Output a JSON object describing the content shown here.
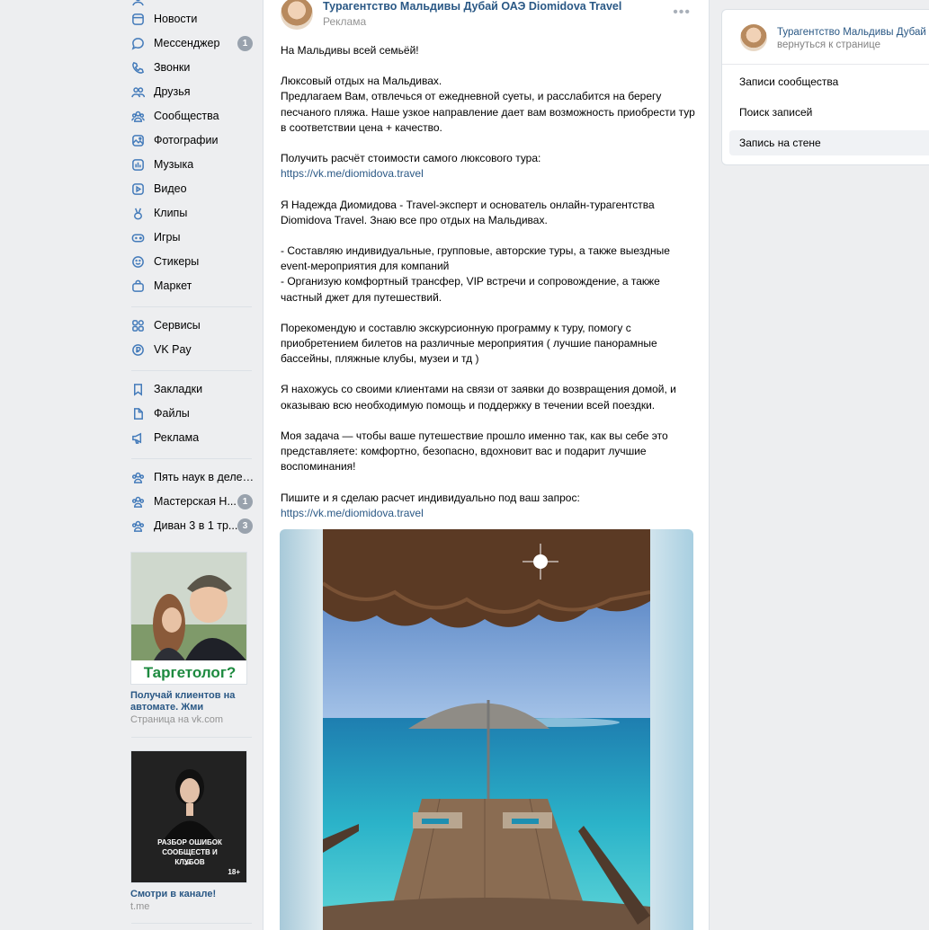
{
  "sidebar": {
    "items": [
      {
        "label": "Новости",
        "icon": "news-icon",
        "badge": ""
      },
      {
        "label": "Мессенджер",
        "icon": "messenger-icon",
        "badge": "1"
      },
      {
        "label": "Звонки",
        "icon": "phone-icon",
        "badge": ""
      },
      {
        "label": "Друзья",
        "icon": "friends-icon",
        "badge": ""
      },
      {
        "label": "Сообщества",
        "icon": "communities-icon",
        "badge": ""
      },
      {
        "label": "Фотографии",
        "icon": "photos-icon",
        "badge": ""
      },
      {
        "label": "Музыка",
        "icon": "music-icon",
        "badge": ""
      },
      {
        "label": "Видео",
        "icon": "video-icon",
        "badge": ""
      },
      {
        "label": "Клипы",
        "icon": "clips-icon",
        "badge": ""
      },
      {
        "label": "Игры",
        "icon": "games-icon",
        "badge": ""
      },
      {
        "label": "Стикеры",
        "icon": "stickers-icon",
        "badge": ""
      },
      {
        "label": "Маркет",
        "icon": "market-icon",
        "badge": ""
      },
      {
        "label": "Сервисы",
        "icon": "services-icon",
        "badge": ""
      },
      {
        "label": "VK Pay",
        "icon": "vkpay-icon",
        "badge": ""
      },
      {
        "label": "Закладки",
        "icon": "bookmarks-icon",
        "badge": ""
      },
      {
        "label": "Файлы",
        "icon": "files-icon",
        "badge": ""
      },
      {
        "label": "Реклама",
        "icon": "ads-icon",
        "badge": ""
      },
      {
        "label": "Пять наук в деле | ...",
        "icon": "community-icon",
        "badge": ""
      },
      {
        "label": "Мастерская Н...",
        "icon": "community-icon",
        "badge": "1"
      },
      {
        "label": "Диван 3 в 1 тр...",
        "icon": "community-icon",
        "badge": "3"
      }
    ],
    "ads": [
      {
        "image_caption": "Таргетолог?",
        "title": "Получай клиентов на автомате. Жми",
        "subtitle": "Страница на vk.com"
      },
      {
        "image_caption": "РАЗБОР ОШИБОК СООБЩЕСТВ И КЛУБОВ",
        "image_badge": "18+",
        "title": "Смотри в канале!",
        "subtitle": "t.me"
      }
    ]
  },
  "post": {
    "author": "Турагентство Мальдивы Дубай ОАЭ Diomidova Travel",
    "label": "Реклама",
    "more": "•••",
    "paragraphs": [
      {
        "text": "На Мальдивы всей семьёй!"
      },
      {
        "text": "Люксовый отдых на Мальдивах.\nПредлагаем Вам, отвлечься от ежедневной суеты, и расслабится на берегу песчаного пляжа. Наше узкое направление дает вам возможность приобрести тур в соответствии цена + качество."
      },
      {
        "text": "Получить расчёт стоимости самого люксового тура:",
        "link": "https://vk.me/diomidova.travel"
      },
      {
        "text": "Я Надежда Диомидова - Travel-эксперт и основатель онлайн-турагентства Diomidova Travel. Знаю все про отдых на Мальдивах."
      },
      {
        "text": "- Составляю индивидуальные, групповые, авторские туры, а также выездные event-мероприятия для компаний\n- Организую комфортный трансфер, VIP встречи и сопровождение, а также частный джет для путешествий."
      },
      {
        "text": "Порекомендую и составлю экскурсионную программу к туру, помогу с приобретением билетов на различные мероприятия ( лучшие панорамные бассейны, пляжные клубы, музеи и тд )"
      },
      {
        "text": "Я нахожусь со своими клиентами на связи от заявки до возвращения домой, и оказываю всю необходимую помощь и поддержку в течении всей поездки."
      },
      {
        "text": "Моя задача — чтобы ваше путешествие прошло именно так, как вы себе это представляете: комфортно, безопасно, вдохновит вас и подарит лучшие воспоминания!"
      },
      {
        "text": "Пишите и я сделаю расчет индивидуально под ваш запрос:",
        "link": "https://vk.me/diomidova.travel"
      }
    ]
  },
  "right_panel": {
    "name": "Турагентство Мальдивы Дубай ОАЭ",
    "back": "вернуться к странице",
    "items": [
      "Записи сообщества",
      "Поиск записей",
      "Запись на стене"
    ]
  },
  "colors": {
    "link": "#2a5885",
    "accent": "#447bba",
    "badge": "#99a2ad",
    "bg": "#edeef0"
  }
}
